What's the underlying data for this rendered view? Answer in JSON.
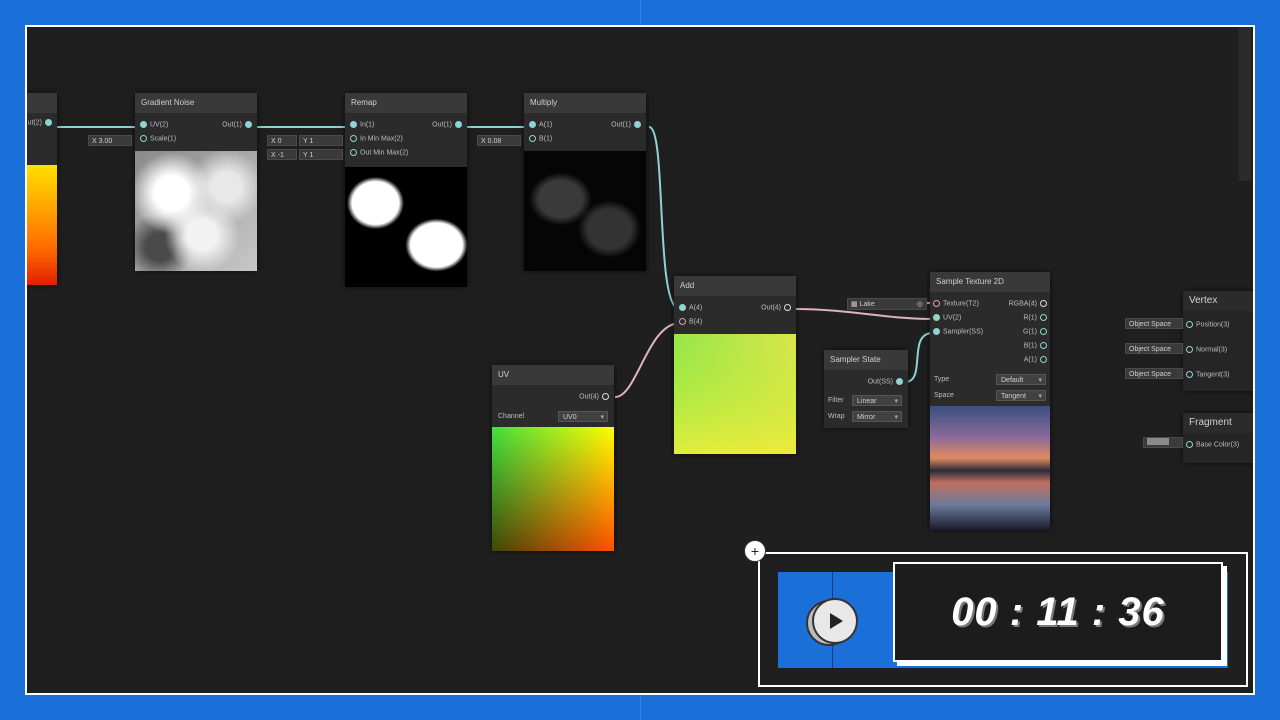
{
  "nodes": {
    "gradient_noise": {
      "title": "Gradient Noise",
      "in_uv": "UV(2)",
      "in_scale": "Scale(1)",
      "out": "Out(1)",
      "scale_x": "X",
      "scale_val": "3.00"
    },
    "left_partial": {
      "out": "ut(2)"
    },
    "remap": {
      "title": "Remap",
      "in_in": "In(1)",
      "in_minmax": "In Min Max(2)",
      "out_minmax": "Out Min Max(2)",
      "out": "Out(1)",
      "row1_x": "X",
      "row1_xv": "0",
      "row1_y": "Y",
      "row1_yv": "1",
      "row2_x": "X",
      "row2_xv": "-1",
      "row2_y": "Y",
      "row2_yv": "1"
    },
    "multiply": {
      "title": "Multiply",
      "in_a": "A(1)",
      "in_b": "B(1)",
      "out": "Out(1)",
      "b_x": "X",
      "b_val": "0.08"
    },
    "add": {
      "title": "Add",
      "in_a": "A(4)",
      "in_b": "B(4)",
      "out": "Out(4)"
    },
    "uv": {
      "title": "UV",
      "out": "Out(4)",
      "channel_label": "Channel",
      "channel_value": "UV0"
    },
    "sampler_state": {
      "title": "Sampler State",
      "out": "Out(SS)",
      "filter_label": "Filter",
      "filter_value": "Linear",
      "wrap_label": "Wrap",
      "wrap_value": "Mirror"
    },
    "sample_texture": {
      "title": "Sample Texture 2D",
      "in_texture": "Texture(T2)",
      "in_uv": "UV(2)",
      "in_sampler": "Sampler(SS)",
      "out_rgba": "RGBA(4)",
      "out_r": "R(1)",
      "out_g": "G(1)",
      "out_b": "B(1)",
      "out_a": "A(1)",
      "type_label": "Type",
      "type_value": "Default",
      "space_label": "Space",
      "space_value": "Tangent",
      "texture_field": "Lake"
    },
    "vertex": {
      "title": "Vertex",
      "position": "Position(3)",
      "normal": "Normal(3)",
      "tangent": "Tangent(3)",
      "pos_space": "Object Space",
      "norm_space": "Object Space",
      "tan_space": "Object Space"
    },
    "fragment": {
      "title": "Fragment",
      "base_color": "Base Color(3)"
    }
  },
  "timer": {
    "value": "00 : 11 : 36",
    "plus_label": "+"
  },
  "colors": {
    "border_blue": "#1a6fd8",
    "canvas": "#1f1f1f",
    "node_header": "#393939",
    "wire_teal": "#8fd3d3",
    "wire_pink": "#e59bb3"
  }
}
